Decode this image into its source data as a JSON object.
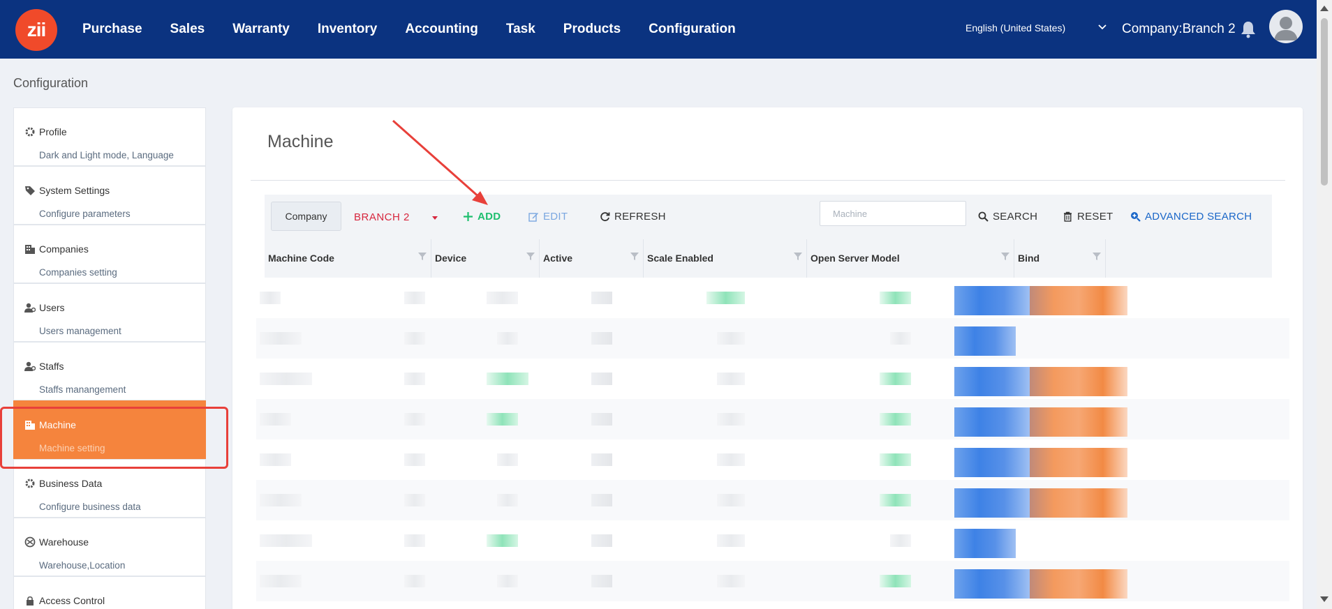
{
  "topbar": {
    "logo_text": "zii",
    "nav": [
      "Purchase",
      "Sales",
      "Warranty",
      "Inventory",
      "Accounting",
      "Task",
      "Products",
      "Configuration"
    ],
    "language": "English (United States)",
    "company": "Company:Branch 2"
  },
  "page": {
    "title": "Configuration"
  },
  "sidebar": {
    "items": [
      {
        "label": "Profile",
        "sub": "Dark and Light mode, Language",
        "icon": "gear-icon"
      },
      {
        "label": "System Settings",
        "sub": "Configure parameters",
        "icon": "tag-icon"
      },
      {
        "label": "Companies",
        "sub": "Companies setting",
        "icon": "building-icon"
      },
      {
        "label": "Users",
        "sub": "Users management",
        "icon": "user-icon"
      },
      {
        "label": "Staffs",
        "sub": "Staffs manangement",
        "icon": "user-icon"
      },
      {
        "label": "Machine",
        "sub": "Machine setting",
        "icon": "building-icon",
        "active": true
      },
      {
        "label": "Business Data",
        "sub": "Configure business data",
        "icon": "gear-icon"
      },
      {
        "label": "Warehouse",
        "sub": "Warehouse,Location",
        "icon": "warehouse-icon"
      },
      {
        "label": "Access Control",
        "sub": "",
        "icon": "lock-icon"
      }
    ]
  },
  "main": {
    "title": "Machine",
    "toolbar": {
      "company_label": "Company",
      "branch_label": "BRANCH 2",
      "add_label": "ADD",
      "edit_label": "EDIT",
      "refresh_label": "REFRESH",
      "search_placeholder": "Machine",
      "search_label": "SEARCH",
      "reset_label": "RESET",
      "advanced_label": "ADVANCED SEARCH"
    },
    "table": {
      "columns": [
        "Machine Code",
        "Device",
        "Active",
        "Scale Enabled",
        "Open Server Model",
        "Bind",
        ""
      ]
    }
  },
  "colors": {
    "header_bg": "#0b3380",
    "active_item": "#f5843d",
    "add": "#1fbf6f",
    "branch": "#d7263d",
    "advanced": "#1a66c8",
    "annotation": "#e8403a"
  }
}
